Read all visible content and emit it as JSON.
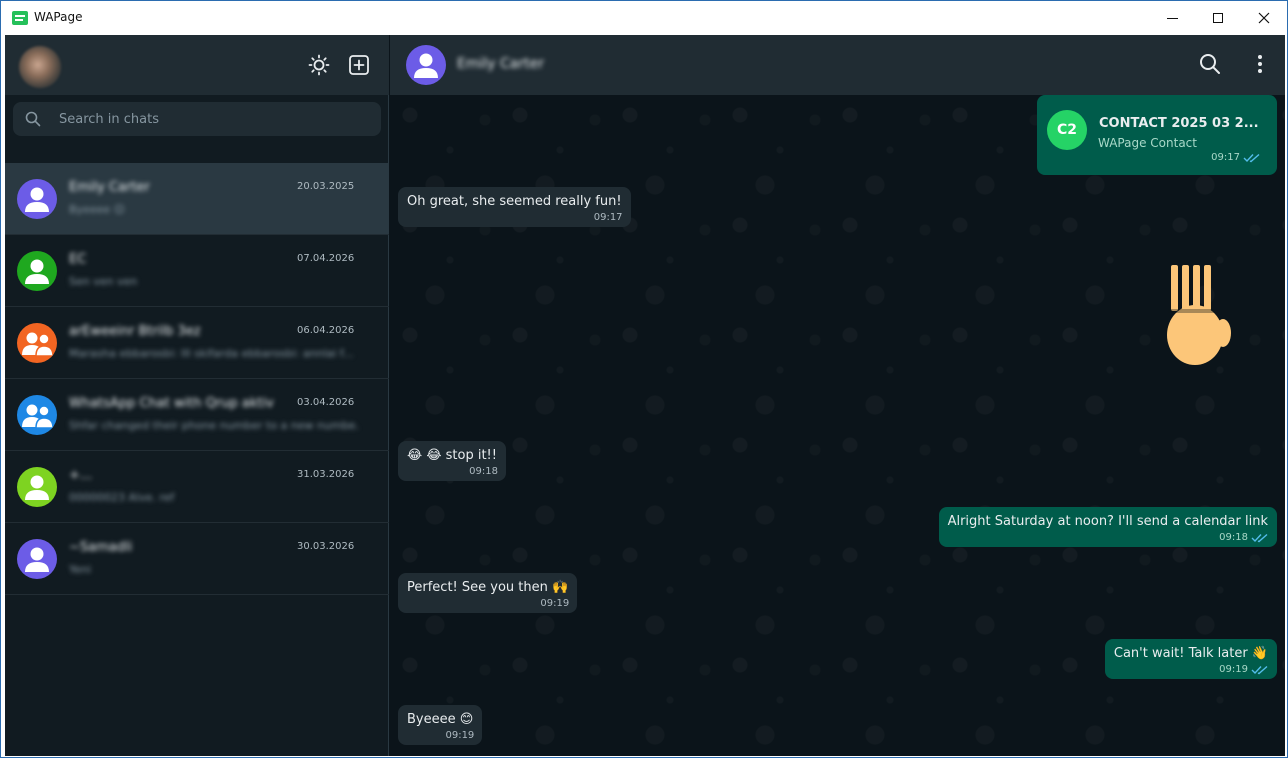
{
  "window": {
    "title": "WAPage"
  },
  "sidebar": {
    "search": {
      "placeholder": "Search in chats",
      "value": ""
    },
    "chats": [
      {
        "name": "Emily Carter",
        "preview": "Byeeee 😊",
        "date": "20.03.2025",
        "avatar_color": "#6c5ce7",
        "type": "person",
        "active": true
      },
      {
        "name": "EC",
        "preview": "Sen ven ven",
        "date": "07.04.2026",
        "avatar_color": "#1fa81f",
        "type": "person",
        "active": false
      },
      {
        "name": "arEweeinr Btrilb 3ez",
        "preview": "Marasha ebbarosbi: III skifarda ebbarosbi: annlai f...",
        "date": "06.04.2026",
        "avatar_color": "#f26522",
        "type": "group",
        "active": false
      },
      {
        "name": "WhatsApp Chat with Qrup aktiv",
        "preview": "Shfar changed their phone number to a new numbe...",
        "date": "03.04.2026",
        "avatar_color": "#1e88e5",
        "type": "group",
        "active": false
      },
      {
        "name": "+...",
        "preview": "00000023 Alve. ref",
        "date": "31.03.2026",
        "avatar_color": "#7ed321",
        "type": "person",
        "active": false
      },
      {
        "name": "~Samadli",
        "preview": "Yeni",
        "date": "30.03.2026",
        "avatar_color": "#6c5ce7",
        "type": "person",
        "active": false
      }
    ]
  },
  "conversation": {
    "contact_name": "Emily Carter",
    "avatar_color": "#6c5ce7",
    "contact_card": {
      "initials": "C2",
      "title": "CONTACT 2025 03 2...",
      "subtitle": "WAPage Contact",
      "time": "09:17"
    },
    "messages": [
      {
        "direction": "in",
        "text": "Oh great, she seemed really fun!",
        "time": "09:17"
      },
      {
        "direction": "in",
        "text": "😂 😂 stop it!!",
        "time": "09:18"
      },
      {
        "direction": "out",
        "text": "Alright Saturday at noon? I'll send a calendar link",
        "time": "09:18"
      },
      {
        "direction": "in",
        "text": "Perfect! See you then 🙌",
        "time": "09:19"
      },
      {
        "direction": "out",
        "text": "Can't wait! Talk later 👋",
        "time": "09:19"
      },
      {
        "direction": "in",
        "text": "Byeeee 😊",
        "time": "09:19"
      }
    ]
  },
  "colors": {
    "outgoing_bubble": "#005c4b",
    "incoming_bubble": "#202c33",
    "read_ticks": "#53bdeb",
    "accent": "#25d366"
  }
}
